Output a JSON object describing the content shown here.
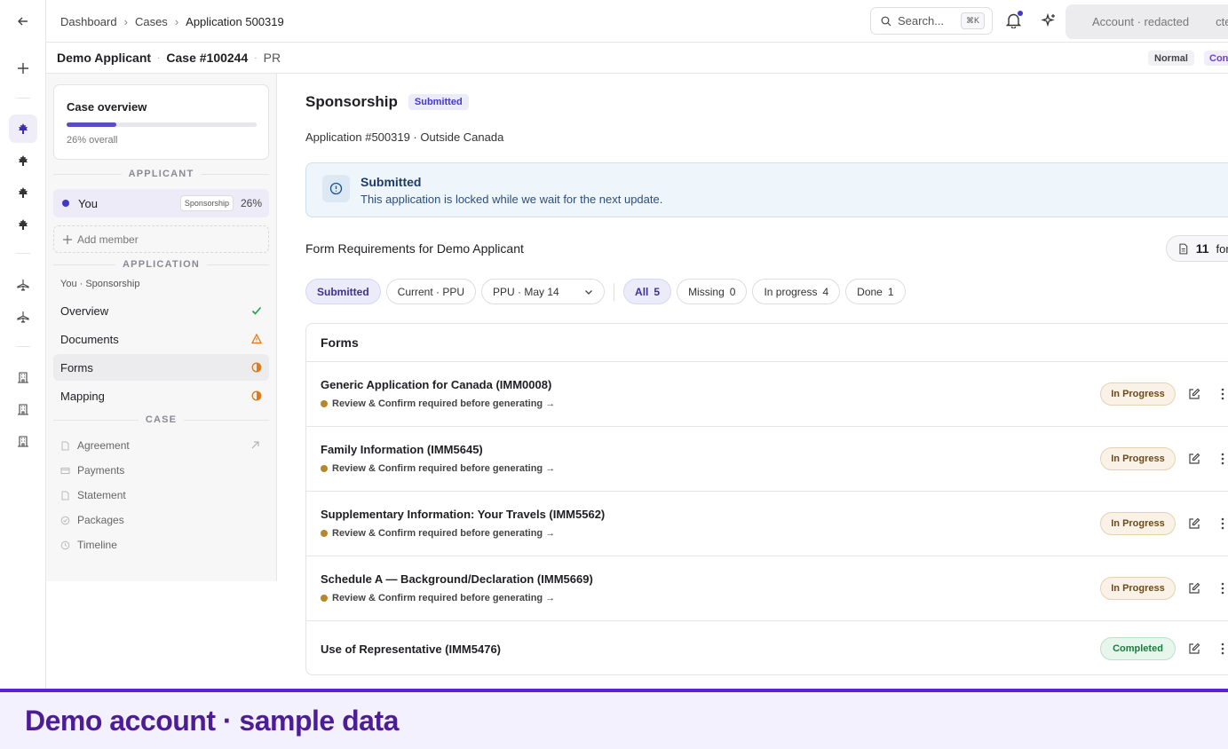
{
  "breadcrumb": [
    "Dashboard",
    "Cases",
    "Application 500319"
  ],
  "search": {
    "label": "Search...",
    "shortcut": "⌘K"
  },
  "account": {
    "label": "Account · redacted",
    "overflow": "cte"
  },
  "case_header": {
    "applicant": "Demo Applicant",
    "case_number": "Case #100244",
    "type": "PR",
    "priority": "Normal",
    "status_cut": "Con"
  },
  "overview": {
    "title": "Case overview",
    "progress": 0.26,
    "progress_label": "26% overall"
  },
  "sections": {
    "applicant": "APPLICANT",
    "application": "APPLICATION",
    "case": "CASE"
  },
  "member": {
    "name": "You",
    "tag": "Sponsorship",
    "percent": "26%"
  },
  "add_member": "Add member",
  "application_sub": "You · Sponsorship",
  "app_nav": [
    {
      "label": "Overview",
      "status": "done"
    },
    {
      "label": "Documents",
      "status": "warning"
    },
    {
      "label": "Forms",
      "status": "partial"
    },
    {
      "label": "Mapping",
      "status": "partial"
    }
  ],
  "case_nav": [
    "Agreement",
    "Payments",
    "Statement",
    "Packages",
    "Timeline"
  ],
  "page": {
    "title": "Sponsorship",
    "badge": "Submitted",
    "subtitle": "Application #500319 · Outside Canada"
  },
  "alert": {
    "title": "Submitted",
    "message": "This application is locked while we wait for the next update."
  },
  "requirements": {
    "title": "Form Requirements for Demo Applicant",
    "count": "11",
    "count_label": "forms"
  },
  "filters": {
    "submitted": "Submitted",
    "current": "Current · PPU",
    "dropdown": "PPU · May 14",
    "all": {
      "label": "All",
      "count": "5"
    },
    "missing": {
      "label": "Missing",
      "count": "0"
    },
    "in_progress": {
      "label": "In progress",
      "count": "4"
    },
    "done": {
      "label": "Done",
      "count": "1"
    }
  },
  "forms_header": "Forms",
  "forms": [
    {
      "name": "Generic Application for Canada (IMM0008)",
      "note": "Review & Confirm required before generating →",
      "status": "In Progress"
    },
    {
      "name": "Family Information (IMM5645)",
      "note": "Review & Confirm required before generating →",
      "status": "In Progress"
    },
    {
      "name": "Supplementary Information: Your Travels (IMM5562)",
      "note": "Review & Confirm required before generating →",
      "status": "In Progress"
    },
    {
      "name": "Schedule A — Background/Declaration (IMM5669)",
      "note": "Review & Confirm required before generating →",
      "status": "In Progress"
    },
    {
      "name": "Use of Representative (IMM5476)",
      "note": "",
      "status": "Completed"
    }
  ],
  "footer": "Demo account · sample data",
  "colors": {
    "accent": "#4338ca",
    "warning": "#e07b1a",
    "success": "#16a34a",
    "footer": "#4c1d95"
  }
}
